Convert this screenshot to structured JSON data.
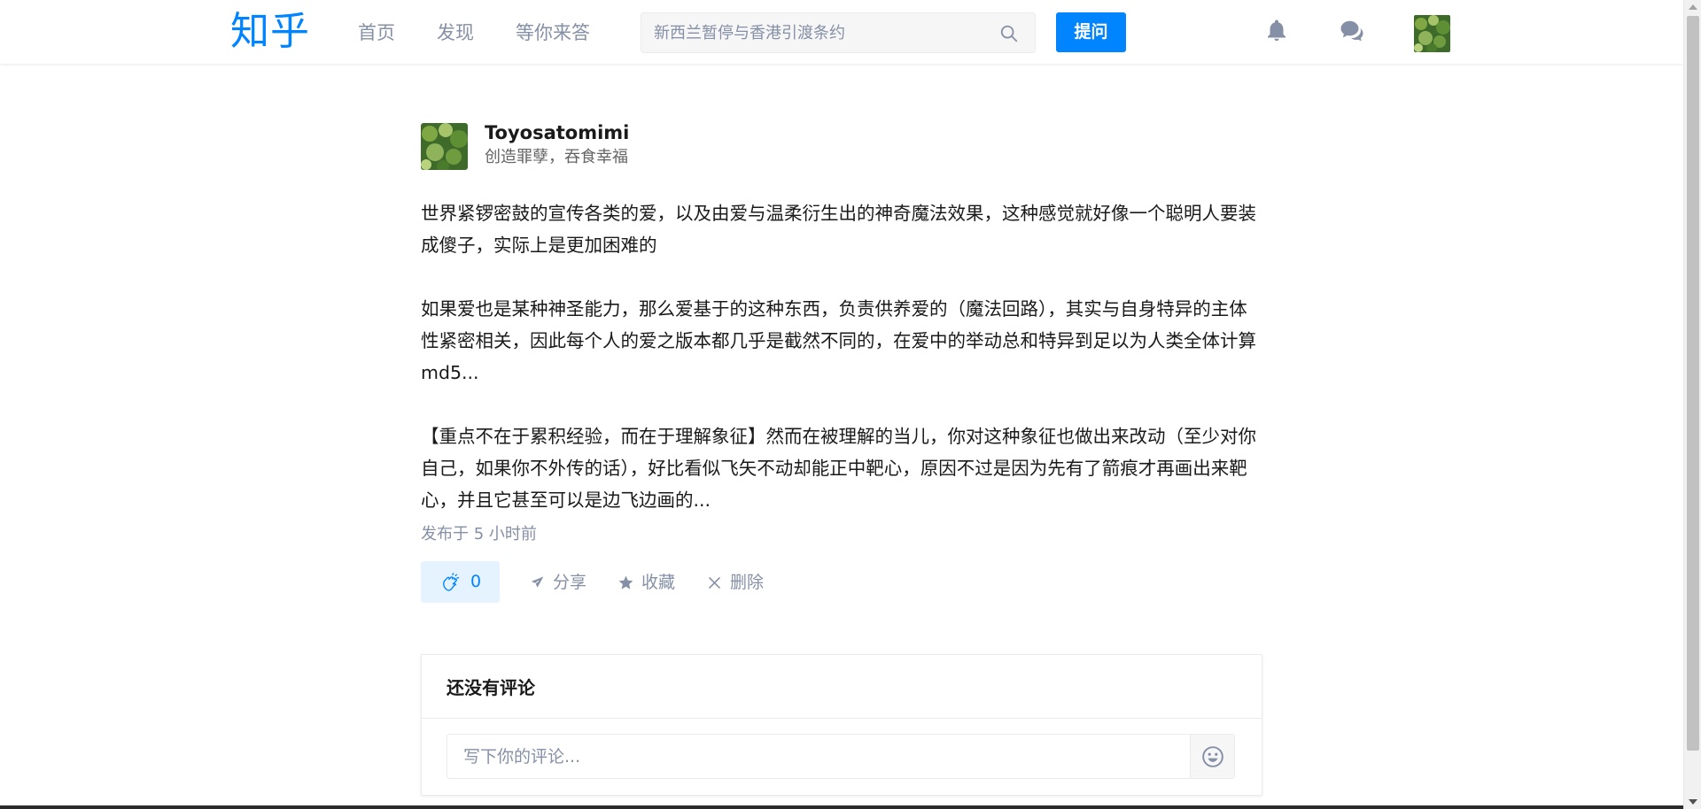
{
  "header": {
    "logo": "知乎",
    "nav": [
      "首页",
      "发现",
      "等你来答"
    ],
    "search_placeholder": "新西兰暂停与香港引渡条约",
    "ask_label": "提问"
  },
  "answer": {
    "author_name": "Toyosatomimi",
    "author_bio": "创造罪孽，吞食幸福",
    "paragraphs": [
      "世界紧锣密鼓的宣传各类的爱，以及由爱与温柔衍生出的神奇魔法效果，这种感觉就好像一个聪明人要装成傻子，实际上是更加困难的",
      "如果爱也是某种神圣能力，那么爱基于的这种东西，负责供养爱的（魔法回路），其实与自身特异的主体性紧密相关，因此每个人的爱之版本都几乎是截然不同的，在爱中的举动总和特异到足以为人类全体计算md5...",
      "【重点不在于累积经验，而在于理解象征】然而在被理解的当儿，你对这种象征也做出来改动（至少对你自己，如果你不外传的话），好比看似飞矢不动却能正中靶心，原因不过是因为先有了箭痕才再画出来靶心，并且它甚至可以是边飞边画的..."
    ],
    "published": "发布于 5 小时前",
    "vote_count": "0",
    "actions": {
      "share": "分享",
      "favorite": "收藏",
      "delete": "删除"
    }
  },
  "comments": {
    "title": "还没有评论",
    "input_placeholder": "写下你的评论..."
  },
  "colors": {
    "brand": "#0084ff",
    "muted": "#8590a6"
  }
}
